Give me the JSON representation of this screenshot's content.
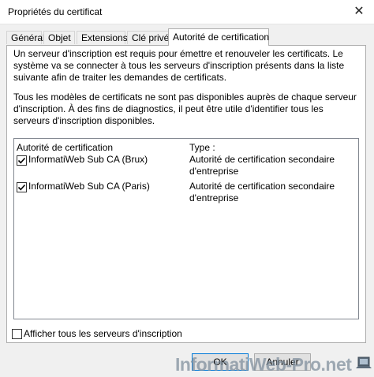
{
  "window": {
    "title": "Propriétés du certificat",
    "close_glyph": "✕"
  },
  "tabs": [
    {
      "label": "Général",
      "active": false
    },
    {
      "label": "Objet",
      "active": false
    },
    {
      "label": "Extensions",
      "active": false
    },
    {
      "label": "Clé privée",
      "active": false
    },
    {
      "label": "Autorité de certification",
      "active": true
    }
  ],
  "description": {
    "paragraph1": "Un serveur d'inscription est requis pour émettre et renouveler les certificats. Le système va se connecter à tous les serveurs d'inscription présents dans la liste suivante afin de traiter les demandes de certificats.",
    "paragraph2": "Tous les modèles de certificats ne sont pas disponibles auprès de chaque serveur d'inscription. À des fins de diagnostics, il peut être utile d'identifier tous les serveurs d'inscription disponibles."
  },
  "server_list": {
    "columns": [
      "Autorité de certification",
      "Type :"
    ],
    "rows": [
      {
        "name": "InformatiWeb Sub CA (Brux)",
        "type": "Autorité de certification secondaire d'entreprise",
        "checked": true
      },
      {
        "name": "InformatiWeb Sub CA (Paris)",
        "type": "Autorité de certification secondaire d'entreprise",
        "checked": true
      }
    ]
  },
  "show_all_checkbox": {
    "label": "Afficher tous les serveurs d'inscription",
    "checked": false
  },
  "buttons": {
    "ok_label": "OK",
    "cancel_label": "Annuler"
  },
  "watermark": {
    "text": "InformatiWeb-Pro.net",
    "icon": "laptop-icon"
  },
  "colors": {
    "window_bg": "#f0f0f0",
    "panel_bg": "#ffffff",
    "primary_button_border": "#0078d7"
  }
}
